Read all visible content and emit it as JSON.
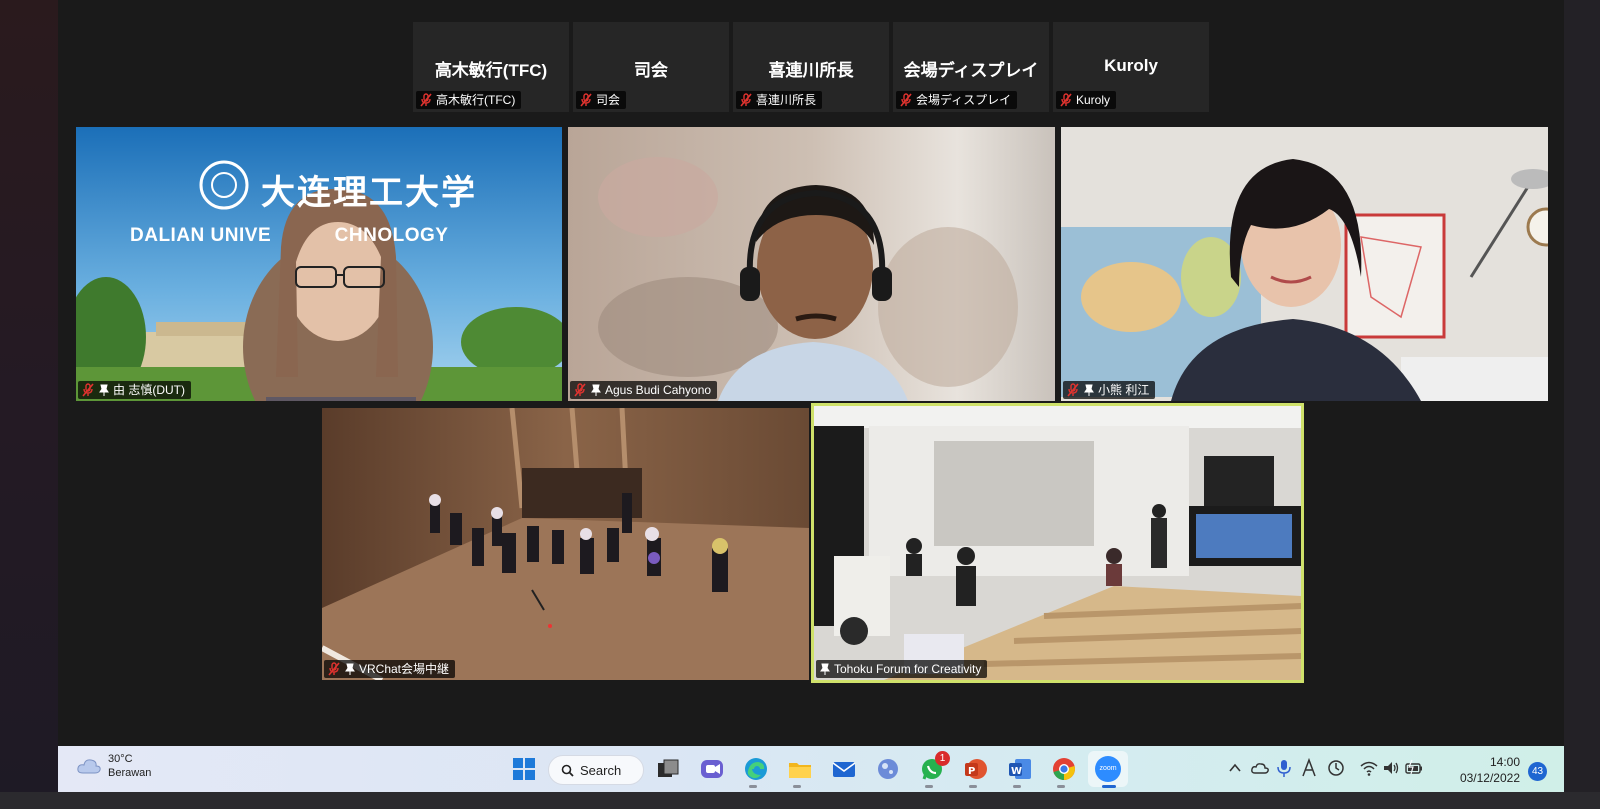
{
  "strip": [
    {
      "name": "高木敏行(TFC)",
      "tag": "高木敏行(TFC)"
    },
    {
      "name": "司会",
      "tag": "司会"
    },
    {
      "name": "喜連川所長",
      "tag": "喜連川所長"
    },
    {
      "name": "会場ディスプレイ",
      "tag": "会場ディスプレイ"
    },
    {
      "name": "Kuroly",
      "tag": "Kuroly"
    }
  ],
  "tiles": [
    {
      "label": "由 志慎(DUT)",
      "banner_cn": "大连理工大学",
      "banner_en": "DALIAN UNIVE           CHNOLOGY"
    },
    {
      "label": "Agus Budi Cahyono"
    },
    {
      "label": "小熊 利江"
    },
    {
      "label": "VRChat会場中継"
    },
    {
      "label": "Tohoku Forum for Creativity"
    }
  ],
  "taskbar": {
    "temp": "30°C",
    "weather": "Berawan",
    "search_label": "Search",
    "whatsapp_badge": "1",
    "zoom_label": "zoom",
    "time": "14:00",
    "date": "03/12/2022",
    "notifications": "43"
  },
  "colors": {
    "active_speaker": "#cfe16a",
    "muted": "#e0332f",
    "accent": "#1f66d1"
  }
}
